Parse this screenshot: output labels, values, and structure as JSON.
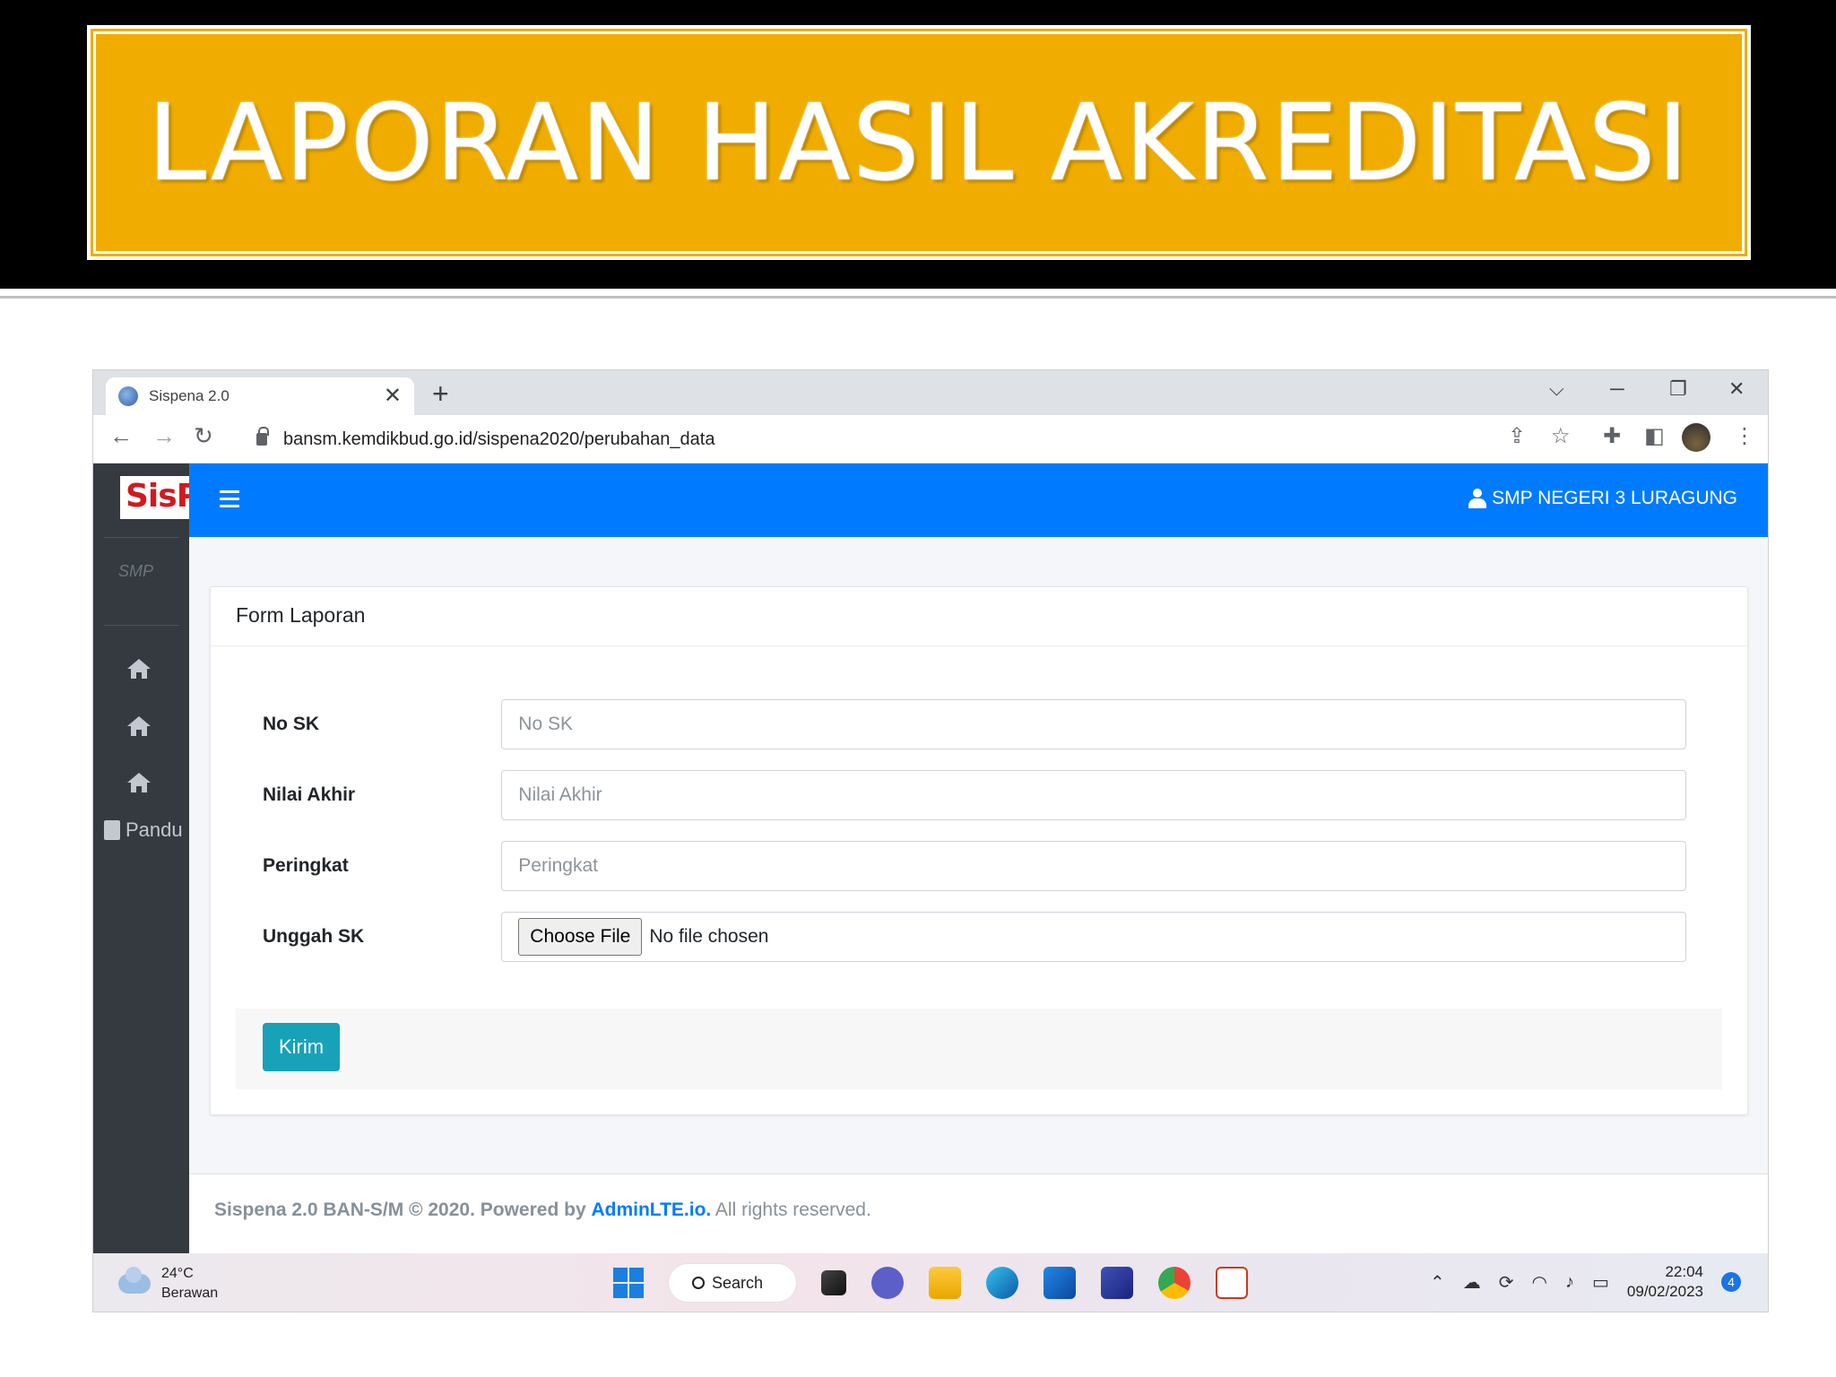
{
  "slide": {
    "title": "LAPORAN HASIL AKREDITASI"
  },
  "browser": {
    "tab_title": "Sispena 2.0",
    "tab_close": "✕",
    "new_tab": "+",
    "url": "bansm.kemdikbud.go.id/sispena2020/perubahan_data",
    "controls": {
      "dropdown": "⌵",
      "minimize": "─",
      "restore": "❐",
      "close": "✕"
    }
  },
  "app": {
    "brand": "SisP",
    "sidebar": {
      "logo_text": "SMP",
      "panduan_label": "Pandu"
    },
    "navbar": {
      "user_label": "SMP NEGERI 3 LURAGUNG"
    },
    "card": {
      "title": "Form Laporan",
      "fields": [
        {
          "label": "No SK",
          "placeholder": "No SK"
        },
        {
          "label": "Nilai Akhir",
          "placeholder": "Nilai Akhir"
        },
        {
          "label": "Peringkat",
          "placeholder": "Peringkat"
        },
        {
          "label": "Unggah SK",
          "button": "Choose File",
          "status": "No file chosen"
        }
      ],
      "submit_label": "Kirim"
    },
    "footer": {
      "prefix": "Sispena 2.0 BAN-S/M © 2020. Powered by",
      "link": "AdminLTE.io.",
      "suffix": "All rights reserved."
    }
  },
  "taskbar": {
    "temperature": "24°C",
    "weather": "Berawan",
    "search_label": "Search",
    "time": "22:04",
    "date": "09/02/2023",
    "notification_count": "4"
  }
}
